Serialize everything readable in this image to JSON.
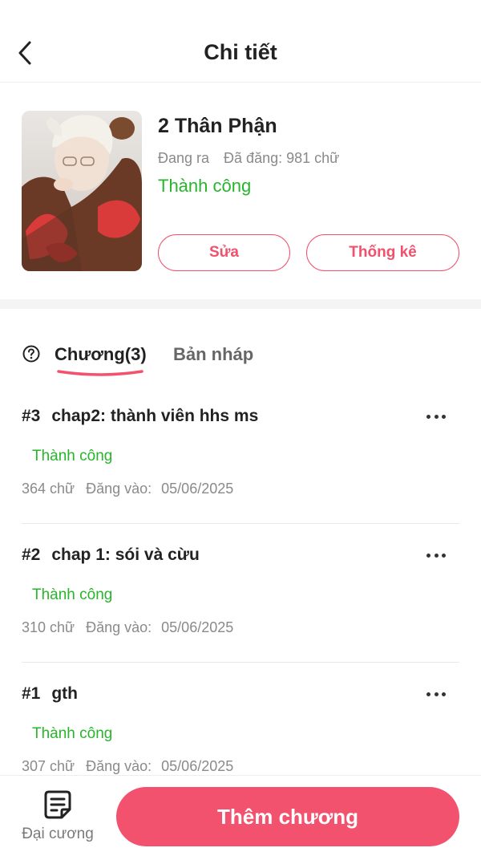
{
  "header": {
    "title": "Chi tiết",
    "back_icon": "chevron-left-icon"
  },
  "story": {
    "title": "2 Thân Phận",
    "status_label": "Đang ra",
    "word_count_label": "Đã đăng: 981 chữ",
    "publish_status": "Thành công",
    "edit_label": "Sửa",
    "stats_label": "Thống kê",
    "cover_alt": "cover-image"
  },
  "tabs": {
    "help_icon": "question-circle-icon",
    "chapters_label": "Chương(3)",
    "drafts_label": "Bản nháp"
  },
  "chapters": [
    {
      "number": "#3",
      "title": "chap2: thành viên hhs ms",
      "status": "Thành công",
      "words": "364 chữ",
      "posted_label": "Đăng vào:",
      "date": "05/06/2025"
    },
    {
      "number": "#2",
      "title": "chap 1: sói và cừu",
      "status": "Thành công",
      "words": "310 chữ",
      "posted_label": "Đăng vào:",
      "date": "05/06/2025"
    },
    {
      "number": "#1",
      "title": "gth",
      "status": "Thành công",
      "words": "307 chữ",
      "posted_label": "Đăng vào:",
      "date": "05/06/2025"
    }
  ],
  "bottom_bar": {
    "outline_label": "Đại cương",
    "outline_icon": "document-icon",
    "add_chapter_label": "Thêm chương"
  },
  "colors": {
    "accent": "#f3526e",
    "success": "#27b52c"
  }
}
